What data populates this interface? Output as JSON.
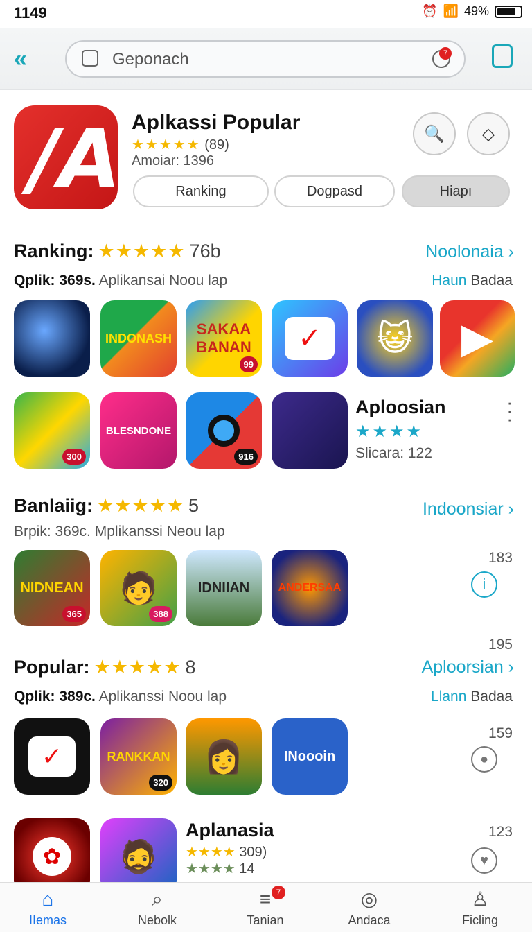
{
  "status": {
    "time": "1149",
    "battery": "49%"
  },
  "search": {
    "placeholder": "Geponach",
    "badge": "7"
  },
  "hero": {
    "title": "Aplkassi Popular",
    "stars": "★★★★★",
    "rating_count": "(89)",
    "subtitle": "Amoiar: 1396",
    "pills": [
      "Ranking",
      "Dogpasd",
      "Hiapı"
    ]
  },
  "section1": {
    "title": "Ranking:",
    "stars": "★★★★★",
    "num": "76b",
    "link": "Noolonaia ›",
    "meta_left": "Qplik: 369s.",
    "meta_mid": "Aplikansai   Noou lap",
    "meta_right_a": "Haun",
    "meta_right_b": "Badaa",
    "tiles": [
      "",
      "INDONASH",
      "SAKAA BANAN",
      "",
      "",
      ""
    ],
    "tag_99": "99",
    "row2_tiles": [
      "",
      "BLESNDONE",
      "",
      ""
    ],
    "row2_tags": [
      "300",
      "",
      "916",
      ""
    ],
    "side_app": {
      "title": "Aploosian",
      "stars": "★★★★",
      "sub": "Slicara: 122"
    }
  },
  "section2": {
    "title": "Banlaiig:",
    "stars": "★★★★★",
    "num": "5",
    "link": "Indoonsiar ›",
    "meta_left": "Brpik: 369c.",
    "meta_mid": "Mplikanssi   Neou lap",
    "tiles": [
      "NIDNEAN",
      "",
      "IDNIIAN",
      "ANDERSAA"
    ],
    "tags": [
      "365",
      "388",
      "",
      ""
    ],
    "side_count": "183",
    "side_count2": "195"
  },
  "section3": {
    "title": "Popular:",
    "stars": "★★★★★",
    "num": "8",
    "link": "Aploorsian ›",
    "meta_left": "Qplik: 389c.",
    "meta_mid": "Aplikanssi   Noou lap",
    "meta_right_a": "Llann",
    "meta_right_b": "Badaa",
    "tiles": [
      "",
      "RANKKAN",
      "",
      "INoooin"
    ],
    "tags": [
      "",
      "320",
      "",
      ""
    ],
    "side_count": "159",
    "side_count2": "123"
  },
  "section4": {
    "title": "Aplanasia",
    "stars1": "★★★★",
    "count1": "309)",
    "stars2": "★★★★",
    "count2": "14"
  },
  "nav": [
    {
      "label": "IIemas",
      "icon": "⌂"
    },
    {
      "label": "Nebolk",
      "icon": "⌕"
    },
    {
      "label": "Tanian",
      "icon": "≡",
      "badge": "7"
    },
    {
      "label": "Andaca",
      "icon": "◎"
    },
    {
      "label": "Ficling",
      "icon": "♙"
    }
  ]
}
